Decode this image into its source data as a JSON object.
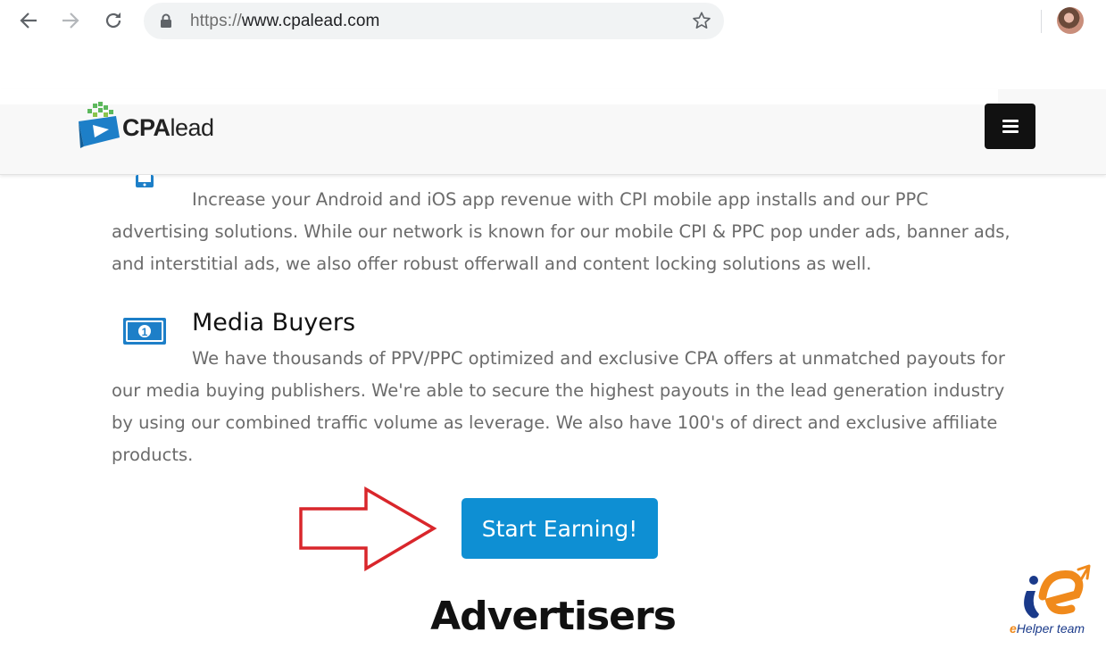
{
  "browser": {
    "url_scheme": "https://",
    "url_host": "www.cpalead.com",
    "icons": {
      "back": "back-arrow-icon",
      "forward": "forward-arrow-icon",
      "reload": "reload-icon",
      "lock": "lock-icon",
      "bookmark": "star-icon",
      "profile": "avatar"
    }
  },
  "site": {
    "logo_bold": "CPA",
    "logo_light": "lead",
    "menu_icon": "hamburger-icon"
  },
  "content": {
    "mobile_para": "Increase your Android and iOS app revenue with CPI mobile app installs and our PPC advertising solutions. While our network is known for our mobile CPI & PPC pop under ads, banner ads, and interstitial ads, we also offer robust offerwall and content locking solutions as well.",
    "media_title": "Media Buyers",
    "media_para": "We have thousands of PPV/PPC optimized and exclusive CPA offers at unmatched payouts for our media buying publishers. We're able to secure the highest payouts in the lead generation industry by using our combined traffic volume as leverage. We also have 100's of direct and exclusive affiliate products.",
    "cta_label": "Start Earning!",
    "advertisers_heading": "Advertisers"
  },
  "watermark": {
    "text_e": "e",
    "text_rest": "Helper team"
  },
  "colors": {
    "cta": "#0e8fd3",
    "arrow": "#d9262b",
    "menu_button": "#111111",
    "body_text": "#6b6b6b"
  }
}
